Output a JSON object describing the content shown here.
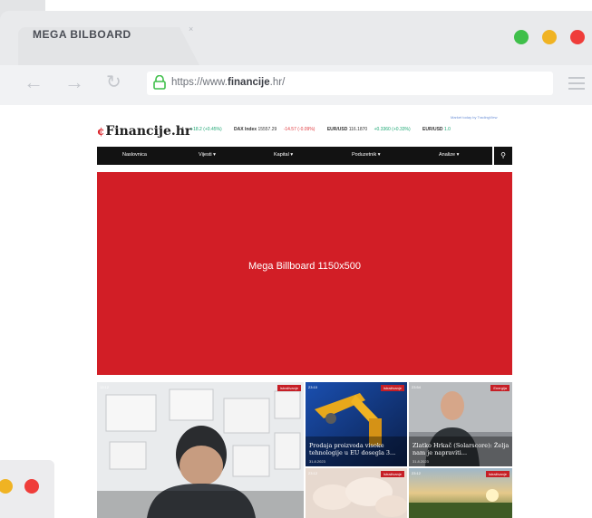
{
  "browser": {
    "tab_title": "MEGA BILBOARD",
    "tab_close": "×",
    "url_prefix": "https://www.",
    "url_domain": "financije",
    "url_suffix": ".hr/",
    "dots": [
      "#3fbf4a",
      "#f0b323",
      "#ef3d3a"
    ]
  },
  "site": {
    "logo": "Financije.hr",
    "logo_mark": "¢",
    "tradingview": "Market today by TradingView",
    "ticker": [
      {
        "label": "4",
        "change": "+18.2 (+0.45%)",
        "dir": "up"
      },
      {
        "label": "DAX Index",
        "value": "15557.29",
        "change": "-14.57 (-0.09%)",
        "dir": "dn"
      },
      {
        "label": "EUR/USD",
        "value": "116.1870",
        "change": "+0.3360 (+0.33%)",
        "dir": "up"
      },
      {
        "label": "EUR/USD",
        "value": "1.0",
        "change": "",
        "dir": "up"
      }
    ],
    "nav": [
      "Naslovnica",
      "Vijesti ▾",
      "Kapital ▾",
      "Poduzetnik ▾",
      "Analize ▾"
    ],
    "search_icon": "⚲"
  },
  "billboard": {
    "label": "Mega Billboard 1150x500",
    "color": "#d21e26"
  },
  "cards": [
    {
      "time": "13:12",
      "category": "Istraživanje",
      "title": "",
      "date": ""
    },
    {
      "time": "23:10",
      "category": "Istraživanje",
      "title": "Prodaja proizvoda visoke tehnologije u EU dosegla 3...",
      "date": "31.8.2023"
    },
    {
      "time": "23:54",
      "category": "Energija",
      "title": "Zlatko Hrkač (Solarscore): Želja nam je napraviti...",
      "date": "31.8.2023"
    },
    {
      "time": "23:12",
      "category": "Istraživanje",
      "title": "",
      "date": ""
    },
    {
      "time": "23:12",
      "category": "Istraživanje",
      "title": "",
      "date": ""
    }
  ]
}
